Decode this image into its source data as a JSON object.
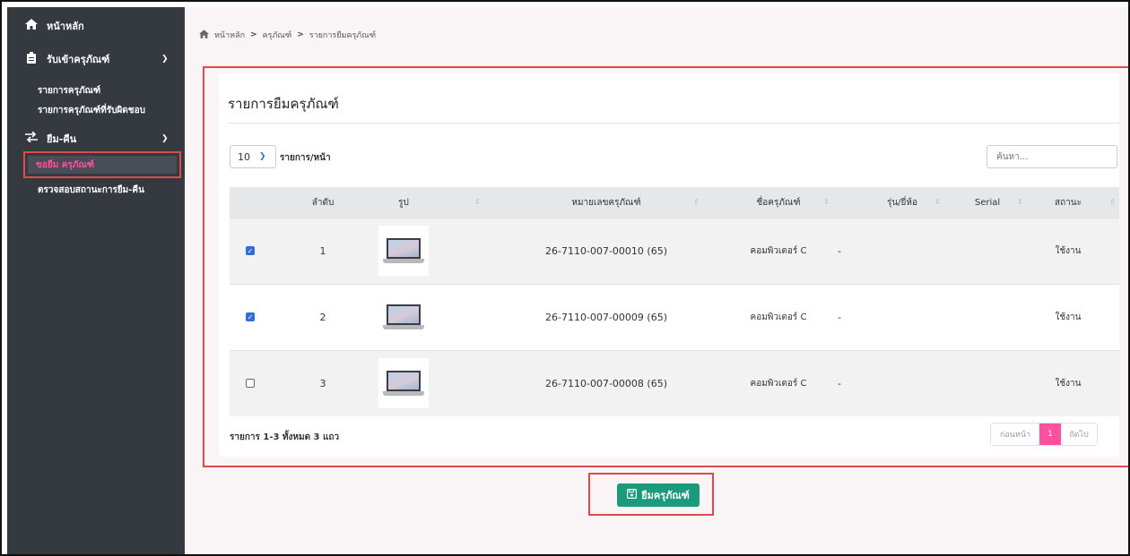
{
  "sidebar": {
    "home": "หน้าหลัก",
    "receive": "รับเข้าครุภัณฑ์",
    "receive_items": [
      "รายการครุภัณฑ์",
      "รายการครุภัณฑ์ที่รับผิดชอบ"
    ],
    "borrow_return": "ยืม-คืน",
    "borrow_request": "ขอยืม ครุภัณฑ์",
    "borrow_status": "ตรวจสอบสถานะการยืม-คืน"
  },
  "breadcrumb": {
    "home": "หน้าหลัก",
    "equipment": "ครุภัณฑ์",
    "current": "รายการยืมครุภัณฑ์",
    "sep": ">"
  },
  "card": {
    "title": "รายการยืมครุภัณฑ์",
    "page_size": "10",
    "page_size_label": "รายการ/หน้า",
    "search_placeholder": "ค้นหา..."
  },
  "table": {
    "columns": [
      "ลำดับ",
      "รูป",
      "หมายเลขครุภัณฑ์",
      "ชื่อครุภัณฑ์",
      "รุ่น/ยี่ห้อ",
      "Serial",
      "สถานะ"
    ],
    "rows": [
      {
        "checked": true,
        "no": "1",
        "asset_no": "26-7110-007-00010 (65)",
        "name": "คอมพิวเตอร์ C",
        "model": "-",
        "serial": "",
        "status": "ใช้งาน"
      },
      {
        "checked": true,
        "no": "2",
        "asset_no": "26-7110-007-00009 (65)",
        "name": "คอมพิวเตอร์ C",
        "model": "-",
        "serial": "",
        "status": "ใช้งาน"
      },
      {
        "checked": false,
        "no": "3",
        "asset_no": "26-7110-007-00008 (65)",
        "name": "คอมพิวเตอร์ C",
        "model": "-",
        "serial": "",
        "status": "ใช้งาน"
      }
    ]
  },
  "footer": {
    "info": "รายการ 1-3 ทั้งหมด 3 แถว",
    "prev": "ก่อนหน้า",
    "page": "1",
    "next": "ถัดไป"
  },
  "submit": {
    "label": "ยืมครุภัณฑ์"
  },
  "colors": {
    "sidebar_bg": "#343a40",
    "accent_pink": "#ff4f9f",
    "submit_green": "#1c9b7c",
    "highlight_red": "#e04a4a",
    "checkbox_blue": "#2f6fdb"
  },
  "icons": {
    "home": "home-icon",
    "clipboard": "clipboard-icon",
    "swap": "swap-arrows-icon",
    "save": "save-icon"
  }
}
